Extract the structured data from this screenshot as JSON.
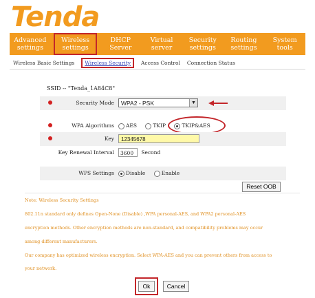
{
  "brand": {
    "logo_text": "Tenda",
    "logo_color": "#f29b1f"
  },
  "nav": {
    "items": [
      {
        "line1": "Advanced",
        "line2": "settings"
      },
      {
        "line1": "Wireless",
        "line2": "settings"
      },
      {
        "line1": "DHCP",
        "line2": "Server"
      },
      {
        "line1": "Virtual",
        "line2": "server"
      },
      {
        "line1": "Security",
        "line2": "settings"
      },
      {
        "line1": "Routing",
        "line2": "settings"
      },
      {
        "line1": "System",
        "line2": "tools"
      }
    ]
  },
  "subnav": {
    "items": [
      "Wireless Basic Settings",
      "Wireless Security",
      "Access Control",
      "Connection Status"
    ]
  },
  "form": {
    "ssid_text": "SSID -- \"Tenda_1A84C8\"",
    "security_mode_label": "Security Mode",
    "security_mode_value": "WPA2 - PSK",
    "wpa_alg_label": "WPA Algorithms",
    "alg_options": [
      "AES",
      "TKIP",
      "TKIP&AES"
    ],
    "key_label": "Key",
    "key_value": "12345678",
    "renewal_label": "Key Renewal Interval",
    "renewal_value": "3600",
    "renewal_unit": "Second",
    "wps_label": "WPS Settings",
    "wps_options": [
      "Disable",
      "Enable"
    ],
    "reset_oob": "Reset OOB"
  },
  "notes": {
    "title": "Note: Wireless Security Settings",
    "line1": "802.11n standard only defines Open-None (Disable) ,WPA personal-AES, and WPA2 personal-AES",
    "line2": "encryption methods. Other encryption methods are non-standard, and compatibility problems may occur",
    "line3": "among different manufacturers.",
    "line4": "Our company has optimized wireless encryption. Select WPA-AES and you can prevent others from access to",
    "line5": "your network."
  },
  "buttons": {
    "ok": "Ok",
    "cancel": "Cancel"
  },
  "colors": {
    "nav_bg": "#f29b1f",
    "highlight": "#c3262a",
    "note_text": "#e09022",
    "key_bg": "#fff9a8"
  }
}
